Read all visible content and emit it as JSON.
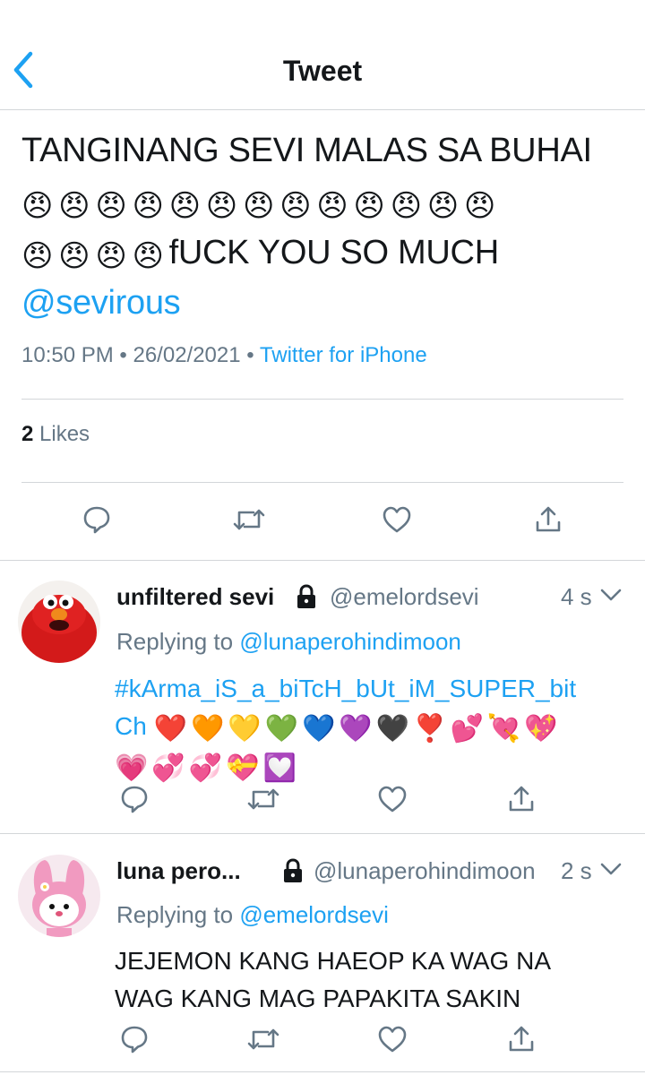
{
  "header": {
    "title": "Tweet",
    "back_icon": "chevron-left-icon",
    "accent": "#1da1f2"
  },
  "main_tweet": {
    "text_line1": "TANGINANG SEVI MALAS SA BUHAI",
    "angry_emojis_row1": [
      "😠",
      "😠",
      "😠",
      "😠",
      "😠",
      "😠",
      "😠",
      "😠",
      "😠",
      "😠",
      "😠",
      "😠",
      "😠"
    ],
    "angry_emojis_row2": [
      "😠",
      "😠",
      "😠",
      "😠"
    ],
    "text_tail": "fUCK YOU SO MUCH",
    "mention": "@sevirous",
    "time": "10:50 PM",
    "sep1": "•",
    "date": "26/02/2021",
    "sep2": "•",
    "source": "Twitter for iPhone",
    "likes_count": "2",
    "likes_label": "Likes"
  },
  "replies": [
    {
      "name": "unfiltered sevi",
      "handle": "@emelordsevi",
      "time": "4 s",
      "replying_label": "Replying to",
      "replying_to": "@lunaperohindimoon",
      "hashtag_line1": "#kArma_iS_a_biTcH_bUt_iM_SUPER_bit",
      "hashtag_line2": "Ch",
      "emojis_row1": [
        "❤️",
        "🧡",
        "💛",
        "💚",
        "💙",
        "💜",
        "🖤",
        "❣️",
        "💕",
        "💘",
        "💖"
      ],
      "emojis_row2": [
        "💗",
        "💞",
        "💞",
        "💝",
        "💟"
      ]
    },
    {
      "name": "luna pero...",
      "handle": "@lunaperohindimoon",
      "time": "2 s",
      "replying_label": "Replying to",
      "replying_to": "@emelordsevi",
      "text_line1": "JEJEMON KANG HAEOP KA WAG NA",
      "text_line2": "WAG KANG MAG PAPAKITA SAKIN"
    }
  ],
  "icons": {
    "reply": "reply-bubble-icon",
    "retweet": "retweet-icon",
    "like": "heart-icon",
    "share": "share-icon",
    "lock": "lock-icon",
    "chevron": "chevron-down-icon"
  }
}
